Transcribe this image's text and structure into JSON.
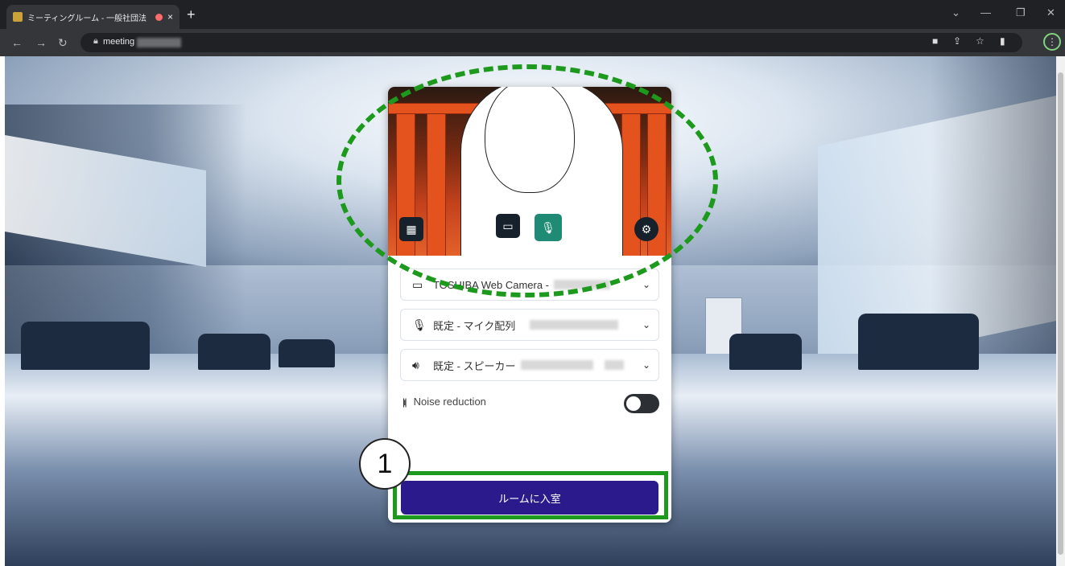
{
  "browser": {
    "tab_title": "ミーティングルーム - 一般社団法",
    "new_tab": "+",
    "tab_close": "×",
    "url": "meeting",
    "window_controls": [
      "⌄",
      "—",
      "❐",
      "✕"
    ]
  },
  "preview": {
    "background_label": "背景",
    "camera_icon": "camera-icon",
    "mic_icon": "microphone-icon",
    "settings_icon": "gear-icon"
  },
  "devices": {
    "camera_label": "TOSHIBA Web Camera -",
    "mic_label": "既定 - マイク配列",
    "speaker_label": "既定 - スピーカー"
  },
  "noise": {
    "label": "Noise reduction",
    "enabled": false
  },
  "join": {
    "label": "ルームに入室"
  },
  "annotation": {
    "step_number": "1"
  },
  "colors": {
    "join_button": "#2b1a8c",
    "annotation": "#1d9a1d",
    "mic_active": "#1f8b74"
  }
}
